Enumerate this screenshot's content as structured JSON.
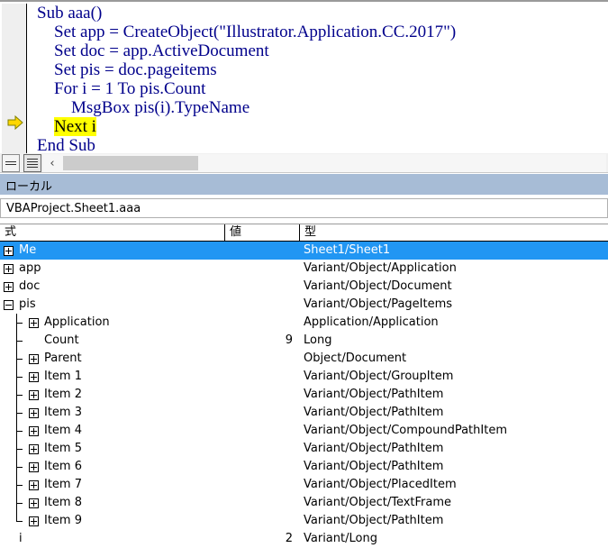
{
  "code_pane": {
    "execution_marker": "current-line-arrow",
    "lines": [
      {
        "text": "Sub aaa()",
        "highlight": null
      },
      {
        "text": "    Set app = CreateObject(\"Illustrator.Application.CC.2017\")",
        "highlight": null
      },
      {
        "text": "    Set doc = app.ActiveDocument",
        "highlight": null
      },
      {
        "text": "    Set pis = doc.pageitems",
        "highlight": null
      },
      {
        "text": "    For i = 1 To pis.Count",
        "highlight": null
      },
      {
        "text": "        MsgBox pis(i).TypeName",
        "highlight": null
      },
      {
        "pre": "    ",
        "highlight": "Next i",
        "post": ""
      },
      {
        "text": "End Sub",
        "highlight": null
      }
    ],
    "code_color": "#00008b",
    "highlight_bg": "#ffff00"
  },
  "code_toolbar": {
    "procedure_view_label": "procedure-view",
    "full_module_view_label": "full-module-view",
    "scroll_left_glyph": "‹"
  },
  "locals": {
    "title": "ローカル",
    "context": "VBAProject.Sheet1.aaa",
    "title_bg": "#a7bcd6",
    "selection_bg": "#2196f3",
    "columns": [
      {
        "key": "expr",
        "label": "式"
      },
      {
        "key": "value",
        "label": "値"
      },
      {
        "key": "type",
        "label": "型"
      }
    ],
    "rows": [
      {
        "expr": "Me",
        "value": "",
        "type": "Sheet1/Sheet1",
        "level": 0,
        "glyph": "plus",
        "selected": true
      },
      {
        "expr": "app",
        "value": "",
        "type": "Variant/Object/Application",
        "level": 0,
        "glyph": "plus",
        "selected": false
      },
      {
        "expr": "doc",
        "value": "",
        "type": "Variant/Object/Document",
        "level": 0,
        "glyph": "plus",
        "selected": false
      },
      {
        "expr": "pis",
        "value": "",
        "type": "Variant/Object/PageItems",
        "level": 0,
        "glyph": "minus",
        "selected": false
      },
      {
        "expr": "Application",
        "value": "",
        "type": "Application/Application",
        "level": 1,
        "glyph": "plus",
        "selected": false
      },
      {
        "expr": "Count",
        "value": "9",
        "type": "Long",
        "level": 1,
        "glyph": "none",
        "selected": false
      },
      {
        "expr": "Parent",
        "value": "",
        "type": "Object/Document",
        "level": 1,
        "glyph": "plus",
        "selected": false
      },
      {
        "expr": "Item 1",
        "value": "",
        "type": "Variant/Object/GroupItem",
        "level": 1,
        "glyph": "plus",
        "selected": false
      },
      {
        "expr": "Item 2",
        "value": "",
        "type": "Variant/Object/PathItem",
        "level": 1,
        "glyph": "plus",
        "selected": false
      },
      {
        "expr": "Item 3",
        "value": "",
        "type": "Variant/Object/PathItem",
        "level": 1,
        "glyph": "plus",
        "selected": false
      },
      {
        "expr": "Item 4",
        "value": "",
        "type": "Variant/Object/CompoundPathItem",
        "level": 1,
        "glyph": "plus",
        "selected": false
      },
      {
        "expr": "Item 5",
        "value": "",
        "type": "Variant/Object/PathItem",
        "level": 1,
        "glyph": "plus",
        "selected": false
      },
      {
        "expr": "Item 6",
        "value": "",
        "type": "Variant/Object/PathItem",
        "level": 1,
        "glyph": "plus",
        "selected": false
      },
      {
        "expr": "Item 7",
        "value": "",
        "type": "Variant/Object/PlacedItem",
        "level": 1,
        "glyph": "plus",
        "selected": false
      },
      {
        "expr": "Item 8",
        "value": "",
        "type": "Variant/Object/TextFrame",
        "level": 1,
        "glyph": "plus",
        "selected": false
      },
      {
        "expr": "Item 9",
        "value": "",
        "type": "Variant/Object/PathItem",
        "level": 1,
        "glyph": "plus",
        "selected": false,
        "last_child": true
      },
      {
        "expr": "i",
        "value": "2",
        "type": "Variant/Long",
        "level": 0,
        "glyph": "none",
        "selected": false
      }
    ]
  }
}
